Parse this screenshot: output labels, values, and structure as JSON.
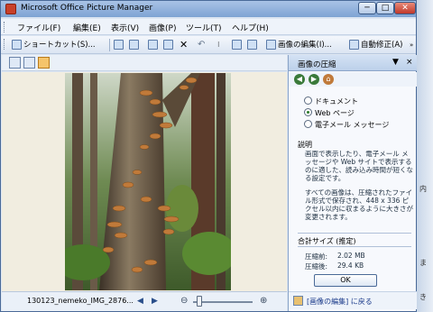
{
  "window": {
    "title": "Microsoft Office Picture Manager",
    "min": "─",
    "max": "□",
    "close": "✕"
  },
  "menu": [
    "ファイル(F)",
    "編集(E)",
    "表示(V)",
    "画像(P)",
    "ツール(T)",
    "ヘルプ(H)"
  ],
  "toolbar": {
    "shortcut": "ショートカット(S)...",
    "edit_image": "画像の編集(I)...",
    "auto_fix": "自動修正(A)"
  },
  "status": {
    "filename": "130123_nemeko_IMG_2876...",
    "prev": "◀",
    "next": "▶",
    "zoom_out": "⊖",
    "zoom_in": "⊕"
  },
  "pane": {
    "title": "画像の圧縮",
    "close": "×",
    "options": [
      "ドキュメント",
      "Web ページ",
      "電子メール メッセージ"
    ],
    "selected_option": 1,
    "desc_heading": "説明",
    "desc1": "画面で表示したり、電子メール メッセージや Web サイトで表示するのに適した、読み込み時間が短くなる設定です。",
    "desc2": "すべての画像は、圧縮されたファイル形式で保存され、448 x 336 ピクセル以内に収まるように大きさが変更されます。",
    "size_heading": "合計サイズ (推定)",
    "before_label": "圧縮前:",
    "before_value": "2.02 MB",
    "after_label": "圧縮後:",
    "after_value": "29.4 KB",
    "ok": "OK",
    "footer_link": "[画像の編集] に戻る"
  },
  "right_strip": [
    "内",
    "ま",
    "き"
  ]
}
